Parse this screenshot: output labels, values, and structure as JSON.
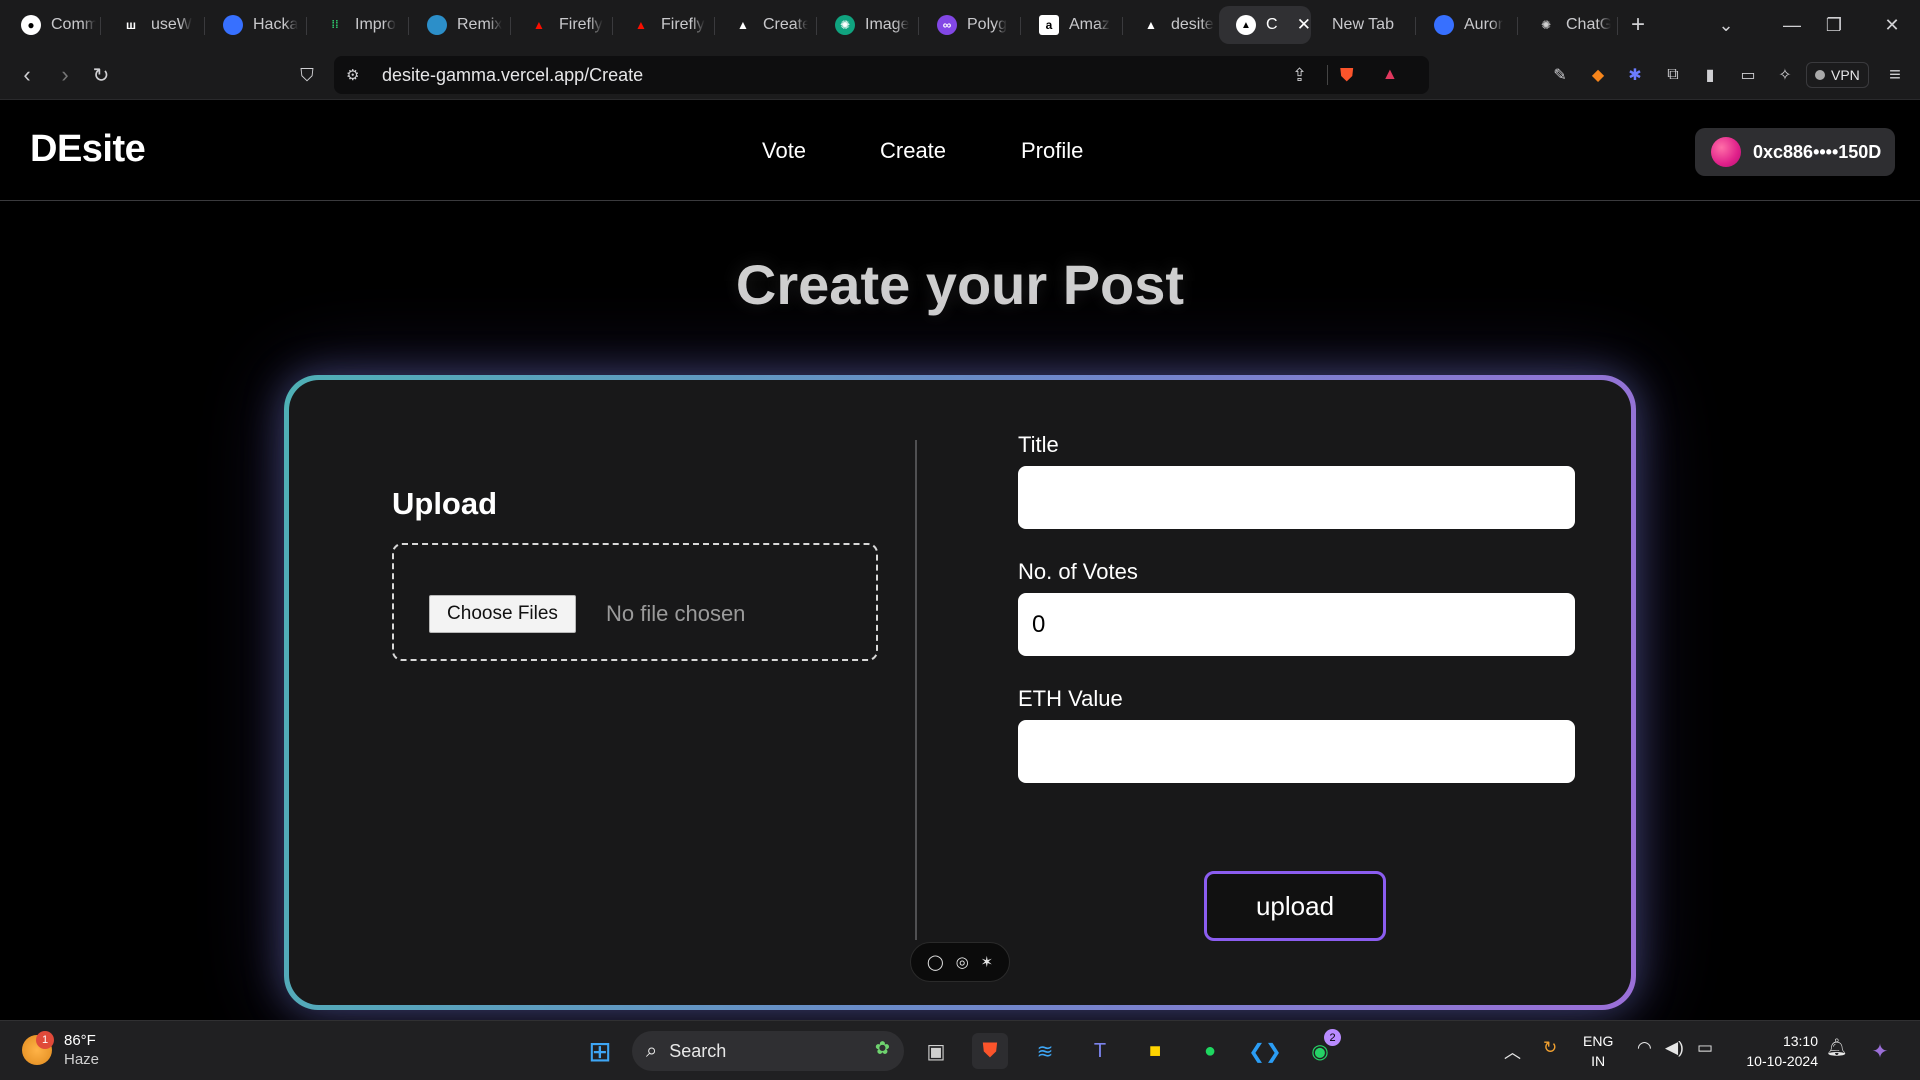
{
  "browser": {
    "tabs": [
      {
        "label": "Comm",
        "icon": "github-icon"
      },
      {
        "label": "useW",
        "icon": "wagmi-icon"
      },
      {
        "label": "Hacka",
        "icon": "devfolio-icon"
      },
      {
        "label": "Impro",
        "icon": "improve-icon"
      },
      {
        "label": "Remix",
        "icon": "remix-icon"
      },
      {
        "label": "Firefly",
        "icon": "adobe-icon"
      },
      {
        "label": "Firefly",
        "icon": "adobe-icon"
      },
      {
        "label": "Create",
        "icon": "vercel-icon"
      },
      {
        "label": "Image",
        "icon": "openai-icon"
      },
      {
        "label": "Polyg",
        "icon": "polygon-icon"
      },
      {
        "label": "Amaz",
        "icon": "amazon-icon"
      },
      {
        "label": "desite",
        "icon": "vercel-icon"
      },
      {
        "label": "C",
        "icon": "vercel-icon",
        "active": true
      },
      {
        "label": "New Tab",
        "icon": ""
      },
      {
        "label": "Auror",
        "icon": "aurora-icon"
      },
      {
        "label": "ChatG",
        "icon": "openai-icon"
      }
    ],
    "url": "desite-gamma.vercel.app/Create",
    "vpn_label": "VPN"
  },
  "site": {
    "logo": "DEsite",
    "nav": {
      "vote": "Vote",
      "create": "Create",
      "profile": "Profile"
    },
    "wallet": "0xc886••••150D",
    "page_title": "Create your Post",
    "form": {
      "upload_heading": "Upload",
      "choose_files": "Choose Files",
      "no_file": "No file chosen",
      "title_label": "Title",
      "title_value": "",
      "votes_label": "No. of Votes",
      "votes_value": "0",
      "eth_label": "ETH Value",
      "eth_value": "",
      "upload_button": "upload"
    }
  },
  "taskbar": {
    "weather_temp": "86°F",
    "weather_desc": "Haze",
    "weather_badge": "1",
    "search": "Search",
    "whatsapp_badge": "2",
    "lang": "ENG",
    "region": "IN",
    "time": "13:10",
    "date": "10-10-2024"
  },
  "colors": {
    "card_gradient_start": "#4fb0b6",
    "card_gradient_end": "#9b6fd8",
    "upload_border": "#8b5df0",
    "wallet_avatar": "#e0208a"
  }
}
